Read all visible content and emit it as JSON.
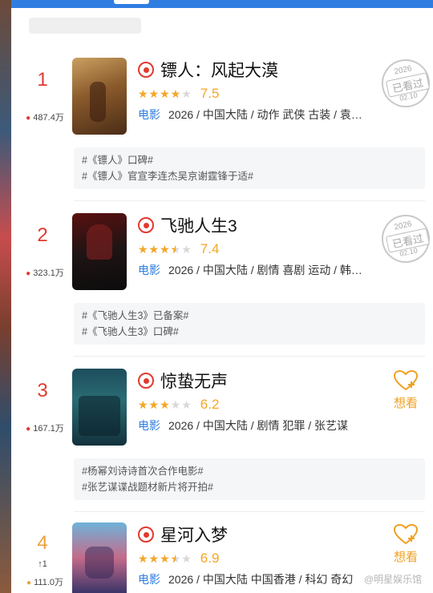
{
  "app": {
    "accent": "#2f7de1",
    "hot_color": "#e23a2e",
    "star_color": "#f5a623"
  },
  "movies": [
    {
      "rank": "1",
      "heat": "487.4万",
      "title": "镖人：风起大漠",
      "stars": 4,
      "score": "7.5",
      "type": "电影",
      "info": "2026 / 中国大陆 / 动作 武侠 古装 / 袁…",
      "topics": [
        "#《镖人》口碑#",
        "#《镖人》官宣李连杰吴京谢霆锋于适#"
      ],
      "action": "seen",
      "stamp": {
        "year": "2026",
        "text": "已看过",
        "date": "02.10"
      }
    },
    {
      "rank": "2",
      "heat": "323.1万",
      "title": "飞驰人生3",
      "stars": 3.5,
      "score": "7.4",
      "type": "电影",
      "info": "2026 / 中国大陆 / 剧情 喜剧 运动 / 韩…",
      "topics": [
        "#《飞驰人生3》已备案#",
        "#《飞驰人生3》口碑#"
      ],
      "action": "seen",
      "stamp": {
        "year": "2026",
        "text": "已看过",
        "date": "02.10"
      }
    },
    {
      "rank": "3",
      "heat": "167.1万",
      "title": "惊蛰无声",
      "stars": 3,
      "score": "6.2",
      "type": "电影",
      "info": "2026 / 中国大陆 / 剧情 犯罪 / 张艺谋",
      "topics": [
        "#杨幂刘诗诗首次合作电影#",
        "#张艺谋谍战题材新片将开拍#"
      ],
      "action": "want",
      "want_label": "想看"
    },
    {
      "rank": "4",
      "trend": "↑1",
      "heat": "111.0万",
      "title": "星河入梦",
      "stars": 3.5,
      "score": "6.9",
      "type": "电影",
      "info": "2026 / 中国大陆 中国香港 / 科幻 奇幻",
      "action": "want",
      "want_label": "想看"
    }
  ],
  "watermark": "@明星娱乐馆"
}
